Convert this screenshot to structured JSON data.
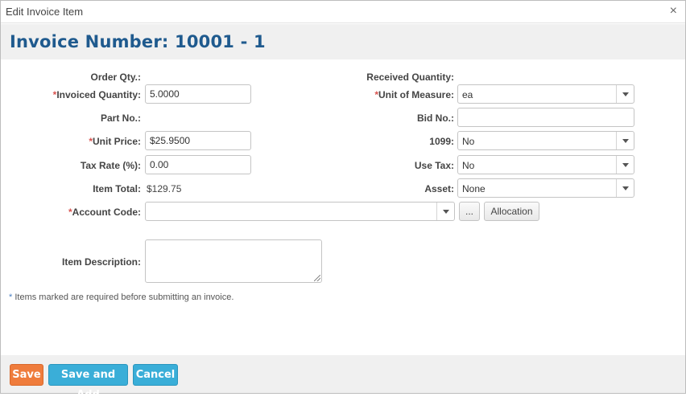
{
  "dialog": {
    "title": "Edit Invoice Item",
    "close_glyph": "×"
  },
  "header": {
    "title": "Invoice Number: 10001 - 1"
  },
  "form": {
    "required_mark": "*",
    "order_qty": {
      "label": "Order Qty.:",
      "value": ""
    },
    "received_qty": {
      "label": "Received Quantity:",
      "value": ""
    },
    "invoiced_qty": {
      "label": "Invoiced Quantity:",
      "value": "5.0000"
    },
    "unit_of_measure": {
      "label": "Unit of Measure:",
      "value": "ea"
    },
    "part_no": {
      "label": "Part No.:",
      "value": ""
    },
    "bid_no": {
      "label": "Bid No.:",
      "value": ""
    },
    "unit_price": {
      "label": "Unit Price:",
      "value": "$25.9500"
    },
    "form_1099": {
      "label": "1099:",
      "value": "No"
    },
    "tax_rate": {
      "label": "Tax Rate (%):",
      "value": "0.00"
    },
    "use_tax": {
      "label": "Use Tax:",
      "value": "No"
    },
    "item_total": {
      "label": "Item Total:",
      "value": "$129.75"
    },
    "asset": {
      "label": "Asset:",
      "value": "None"
    },
    "account_code": {
      "label": "Account Code:",
      "value": "",
      "browse_label": "...",
      "allocation_label": "Allocation"
    },
    "item_description": {
      "label": "Item Description:",
      "value": ""
    }
  },
  "note": {
    "star": "*",
    "text": " Items marked are required before submitting an invoice."
  },
  "footer": {
    "save_label": "Save",
    "save_and_add_label": "Save and Add",
    "cancel_label": "Cancel"
  },
  "colors": {
    "header_title": "#1f5a8e",
    "required": "#d9534f",
    "save_button": "#ef7c3c",
    "blue_button": "#3aaed8"
  }
}
